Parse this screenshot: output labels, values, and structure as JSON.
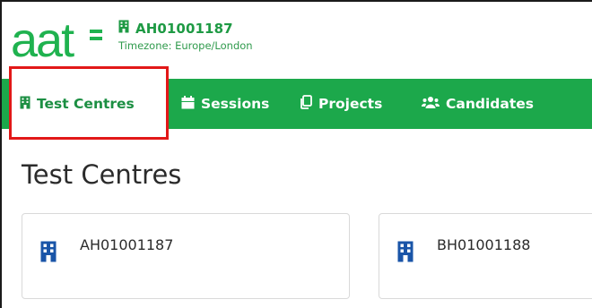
{
  "header": {
    "logo_text": "aat",
    "centre_code": "AH01001187",
    "timezone": "Timezone: Europe/London",
    "building_icon": "building-icon"
  },
  "nav": {
    "items": [
      {
        "label": "Test Centres",
        "icon": "building-icon",
        "active": true
      },
      {
        "label": "Sessions",
        "icon": "calendar-icon",
        "active": false
      },
      {
        "label": "Projects",
        "icon": "copy-icon",
        "active": false
      },
      {
        "label": "Candidates",
        "icon": "users-icon",
        "active": false
      }
    ]
  },
  "main": {
    "title": "Test Centres",
    "cards": [
      {
        "name": "AH01001187",
        "icon": "building-icon"
      },
      {
        "name": "BH01001188",
        "icon": "building-icon"
      }
    ]
  },
  "colors": {
    "brand_green": "#1ca84b",
    "logo_green": "#1fb24f",
    "card_icon_blue": "#1a55a8",
    "highlight_red": "#e21818"
  }
}
